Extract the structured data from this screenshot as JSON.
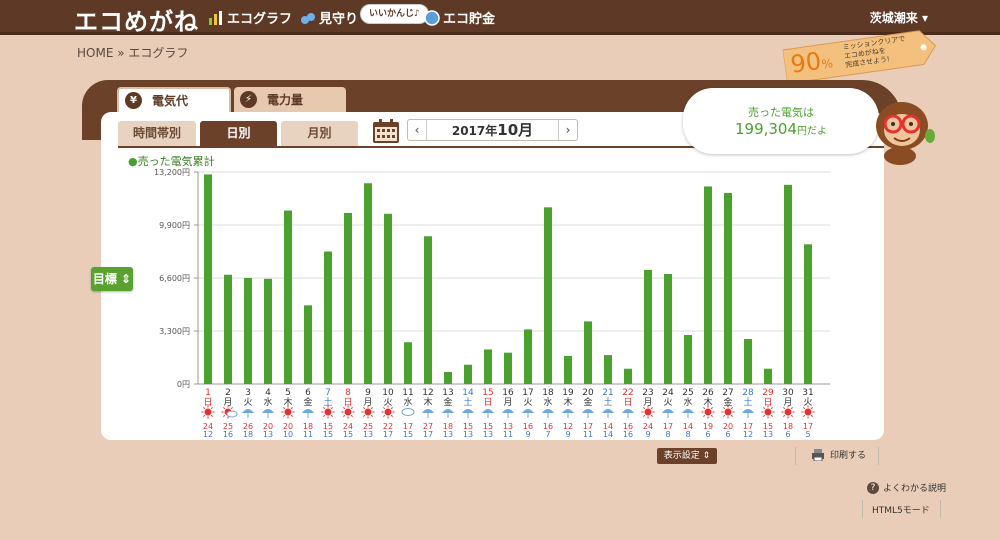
{
  "header": {
    "logo": "エコめがね",
    "nav": [
      {
        "label": "エコグラフ",
        "icon": "bar-chart-icon"
      },
      {
        "label": "見守り",
        "icon": "binoculars-icon"
      },
      {
        "label": "エコ貯金",
        "icon": "coin-icon"
      }
    ],
    "bubble": "いいかんじ♪",
    "user": "茨城潮来 ▾"
  },
  "breadcrumb": "HOME » エコグラフ",
  "main_tabs": [
    {
      "label": "電気代",
      "icon": "yen-icon",
      "active": true
    },
    {
      "label": "電力量",
      "icon": "lightning-icon",
      "active": false
    }
  ],
  "sub_tabs": [
    {
      "label": "時間帯別",
      "active": false
    },
    {
      "label": "日別",
      "active": true
    },
    {
      "label": "月別",
      "active": false
    }
  ],
  "month": {
    "year": "2017年",
    "month": "10月",
    "prev": "‹",
    "next": "›"
  },
  "sold": {
    "label": "売った電気は",
    "value": "199,304",
    "unit": "円だよ"
  },
  "mission": {
    "percent": "90",
    "pct_sign": "%",
    "line1": "ミッションクリアで",
    "line2": "エコめがねを",
    "line3": "完成させよう!"
  },
  "goal_button": "目標 ⇕",
  "display_settings": "表示設定 ⇕",
  "print": "印刷する",
  "help": "よくわかる説明",
  "html5": "HTML5モード",
  "chart_data": {
    "type": "bar",
    "legend": "売った電気累計",
    "yticks": [
      "0円",
      "3,300円",
      "6,600円",
      "9,900円",
      "13,200円"
    ],
    "ylim": [
      0,
      13200
    ],
    "bar_color": "#4aa12e",
    "categories": [
      "1",
      "2",
      "3",
      "4",
      "5",
      "6",
      "7",
      "8",
      "9",
      "10",
      "11",
      "12",
      "13",
      "14",
      "15",
      "16",
      "17",
      "18",
      "19",
      "20",
      "21",
      "22",
      "23",
      "24",
      "25",
      "26",
      "27",
      "28",
      "29",
      "30",
      "31"
    ],
    "weekdays": [
      "日",
      "月",
      "火",
      "水",
      "木",
      "金",
      "土",
      "日",
      "月",
      "火",
      "水",
      "木",
      "金",
      "土",
      "日",
      "月",
      "火",
      "水",
      "木",
      "金",
      "土",
      "日",
      "月",
      "火",
      "水",
      "木",
      "金",
      "土",
      "日",
      "月",
      "火"
    ],
    "values": [
      13050,
      6800,
      6600,
      6550,
      10800,
      4900,
      8250,
      10650,
      12500,
      10600,
      2600,
      9200,
      750,
      1200,
      2150,
      1950,
      3400,
      11000,
      1750,
      3900,
      1800,
      950,
      7100,
      6850,
      3050,
      12300,
      11900,
      2800,
      950,
      12400,
      8700
    ],
    "weather": [
      "sun",
      "sun-cloud",
      "umbrella",
      "umbrella",
      "sun",
      "umbrella",
      "sun",
      "sun",
      "sun",
      "sun",
      "cloud",
      "umbrella",
      "umbrella",
      "umbrella",
      "umbrella",
      "umbrella",
      "umbrella",
      "umbrella",
      "umbrella",
      "umbrella",
      "umbrella",
      "umbrella",
      "sun",
      "umbrella",
      "umbrella",
      "sun",
      "sun",
      "umbrella",
      "sun",
      "sun",
      "sun"
    ],
    "high_temps": [
      "24",
      "25",
      "26",
      "20",
      "20",
      "18",
      "15",
      "24",
      "25",
      "22",
      "17",
      "27",
      "18",
      "15",
      "15",
      "13",
      "16",
      "16",
      "12",
      "17",
      "14",
      "16",
      "24",
      "17",
      "14",
      "19",
      "20",
      "17",
      "15",
      "18",
      "17"
    ],
    "low_temps": [
      "12",
      "16",
      "18",
      "13",
      "10",
      "11",
      "15",
      "15",
      "13",
      "17",
      "15",
      "17",
      "13",
      "13",
      "13",
      "11",
      "9",
      "7",
      "9",
      "11",
      "14",
      "16",
      "9",
      "8",
      "8",
      "6",
      "6",
      "12",
      "13",
      "6",
      "5"
    ]
  }
}
